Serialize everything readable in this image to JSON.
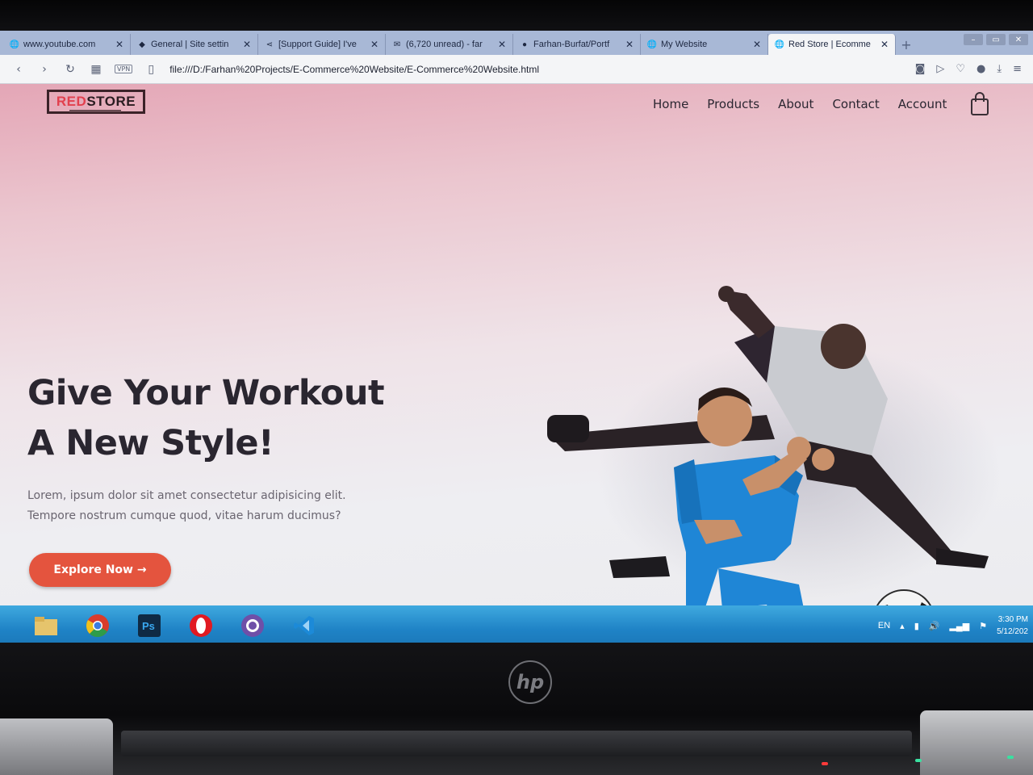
{
  "browser": {
    "tabs": [
      {
        "title": "www.youtube.com",
        "icon": "globe-icon",
        "active": false
      },
      {
        "title": "General | Site settin",
        "icon": "diamond-icon",
        "active": false
      },
      {
        "title": "[Support Guide] I've",
        "icon": "share-icon",
        "active": false
      },
      {
        "title": "(6,720 unread) - far",
        "icon": "mail-icon",
        "active": false
      },
      {
        "title": "Farhan-Burfat/Portf",
        "icon": "github-icon",
        "active": false
      },
      {
        "title": "My Website",
        "icon": "globe-icon",
        "active": false
      },
      {
        "title": "Red Store | Ecomme",
        "icon": "globe-icon",
        "active": true
      }
    ],
    "address": "file:///D:/Farhan%20Projects/E-Commerce%20Website/E-Commerce%20Website.html",
    "vpn_label": "VPN"
  },
  "site": {
    "logo": {
      "red": "RED",
      "dark": "STORE"
    },
    "menu": [
      "Home",
      "Products",
      "About",
      "Contact",
      "Account"
    ],
    "headline_line1": "Give Your Workout",
    "headline_line2": "A New Style!",
    "description_line1": "Lorem, ipsum dolor sit amet consectetur adipisicing elit.",
    "description_line2": "Tempore nostrum cumque quod, vitae harum ducimus?",
    "cta_label": "Explore Now →",
    "colors": {
      "accent": "#e4543e",
      "brand_red": "#e2404e",
      "text": "#2a2630"
    }
  },
  "taskbar": {
    "apps": [
      "file-explorer-icon",
      "chrome-icon",
      "photoshop-icon",
      "opera-icon",
      "github-desktop-icon",
      "vscode-icon"
    ],
    "language": "EN",
    "time": "3:30 PM",
    "date": "5/12/202"
  },
  "device": {
    "brand": "hp"
  }
}
